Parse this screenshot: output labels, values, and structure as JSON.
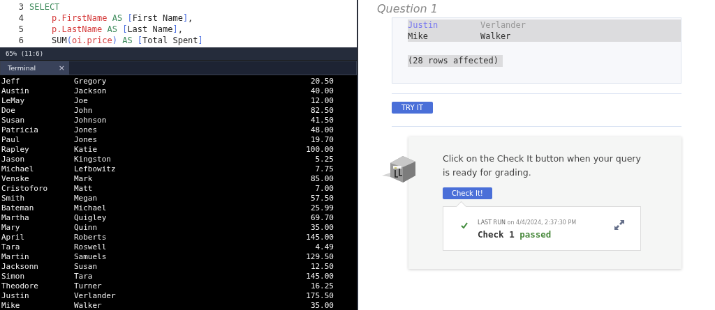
{
  "editor": {
    "lines": [
      {
        "number": "3",
        "tokens": [
          {
            "text": "SELECT",
            "kind": "keyword"
          }
        ],
        "children": [
          {
            "number": "4",
            "tokens": [
              {
                "text": "p.FirstName",
                "kind": "identifier"
              },
              {
                "text": " AS ",
                "kind": "keyword"
              },
              {
                "text": "[",
                "kind": "bracket"
              },
              {
                "text": "First Name",
                "kind": "plain"
              },
              {
                "text": "]",
                "kind": "bracket"
              },
              {
                "text": ",",
                "kind": "plain"
              }
            ]
          },
          {
            "number": "5",
            "tokens": [
              {
                "text": "p.LastName",
                "kind": "identifier"
              },
              {
                "text": " AS ",
                "kind": "keyword"
              },
              {
                "text": "[",
                "kind": "bracket"
              },
              {
                "text": "Last Name",
                "kind": "plain"
              },
              {
                "text": "]",
                "kind": "bracket"
              },
              {
                "text": ",",
                "kind": "plain"
              }
            ]
          },
          {
            "number": "6",
            "tokens": [
              {
                "text": "SUM",
                "kind": "plain"
              },
              {
                "text": "(",
                "kind": "bracket"
              },
              {
                "text": "oi.price",
                "kind": "identifier"
              },
              {
                "text": ")",
                "kind": "bracket"
              },
              {
                "text": " AS ",
                "kind": "keyword"
              },
              {
                "text": "[",
                "kind": "bracket"
              },
              {
                "text": "Total Spent",
                "kind": "plain"
              },
              {
                "text": "]",
                "kind": "bracket"
              }
            ]
          }
        ]
      }
    ]
  },
  "status_bar": "65%  (11:6)",
  "terminal": {
    "tab": {
      "label": "Terminal",
      "close": "×"
    },
    "rows": [
      [
        "Jeff",
        "Gregory",
        "20.50"
      ],
      [
        "Austin",
        "Jackson",
        "40.00"
      ],
      [
        "LeMay",
        "Joe",
        "12.00"
      ],
      [
        "Doe",
        "John",
        "82.50"
      ],
      [
        "Susan",
        "Johnson",
        "41.50"
      ],
      [
        "Patricia",
        "Jones",
        "48.00"
      ],
      [
        "Paul",
        "Jones",
        "19.70"
      ],
      [
        "Rapley",
        "Katie",
        "100.00"
      ],
      [
        "Jason",
        "Kingston",
        "5.25"
      ],
      [
        "Michael",
        "Lefbowitz",
        "7.75"
      ],
      [
        "Venske",
        "Mark",
        "85.00"
      ],
      [
        "Cristoforo",
        "Matt",
        "7.00"
      ],
      [
        "Smith",
        "Megan",
        "57.50"
      ],
      [
        "Bateman",
        "Michael",
        "25.99"
      ],
      [
        "Martha",
        "Quigley",
        "69.70"
      ],
      [
        "Mary",
        "Quinn",
        "35.00"
      ],
      [
        "April",
        "Roberts",
        "145.00"
      ],
      [
        "Tara",
        "Roswell",
        "4.49"
      ],
      [
        "Martin",
        "Samuels",
        "129.50"
      ],
      [
        "Jacksonn",
        "Susan",
        "12.50"
      ],
      [
        "Simon",
        "Tara",
        "145.00"
      ],
      [
        "Theodore",
        "Turner",
        "16.25"
      ],
      [
        "Justin",
        "Verlander",
        "175.50"
      ],
      [
        "Mike",
        "Walker",
        "35.00"
      ]
    ]
  },
  "question": {
    "title": "Question 1",
    "result": {
      "rows": [
        [
          "Justin",
          "Verlander"
        ],
        [
          "Mike",
          "Walker"
        ]
      ],
      "footer": "(28 rows affected)"
    },
    "try_button": "TRY IT",
    "check": {
      "instruction": "Click on the Check It button when your query is ready for grading.",
      "button": "Check It!",
      "last_run": {
        "label": "LAST RUN",
        "time": "on 4/4/2024, 2:37:30 PM",
        "passed": true,
        "check": "Check 1",
        "status": "passed"
      }
    }
  }
}
